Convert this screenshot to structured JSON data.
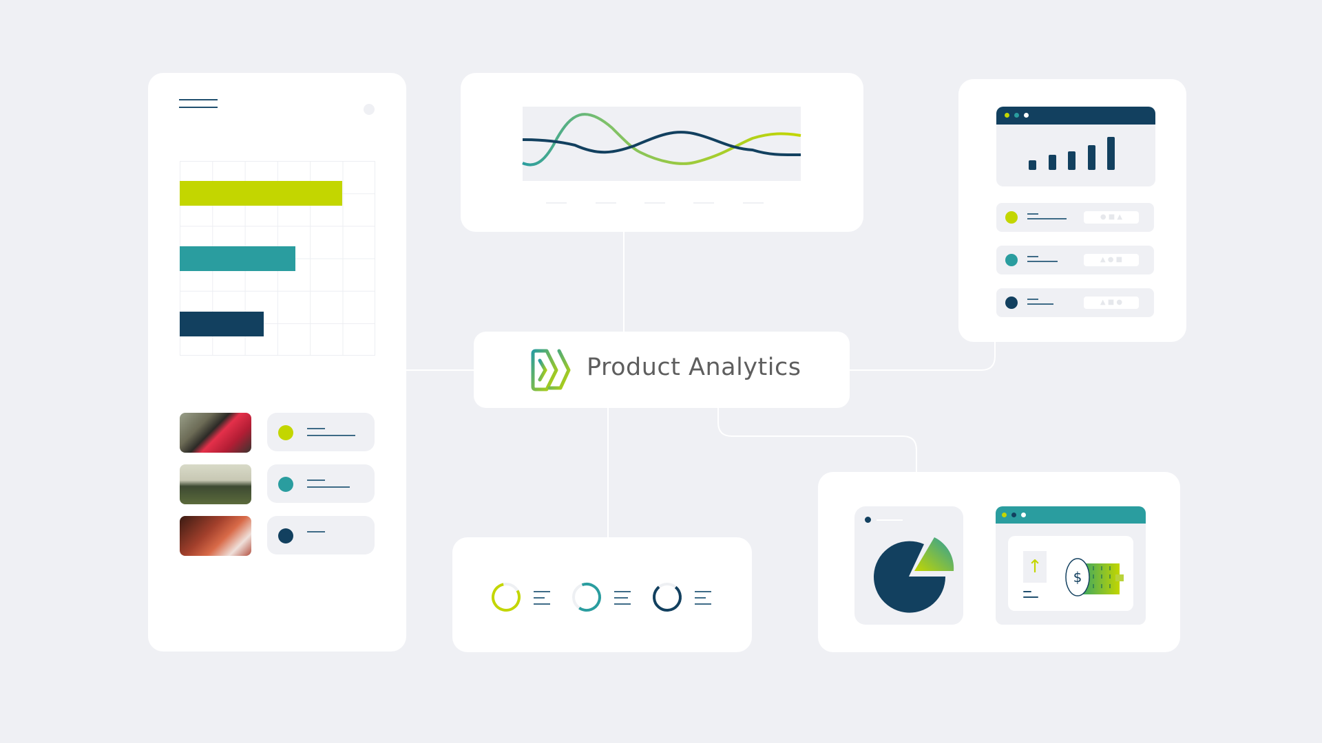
{
  "center_label": {
    "title": "Product Analytics",
    "logo": "chevron-logo"
  },
  "colors": {
    "lime": "#c3d600",
    "teal": "#2a9d9f",
    "navy": "#12405f",
    "background": "#eff0f4",
    "text": "#5e5e5e"
  },
  "left_card": {
    "bars": [
      {
        "color": "#c3d600",
        "fraction": 0.83
      },
      {
        "color": "#2a9d9f",
        "fraction": 0.59
      },
      {
        "color": "#12405f",
        "fraction": 0.43
      }
    ],
    "list_items": [
      {
        "image": "race-car-photo",
        "color": "#c3d600"
      },
      {
        "image": "football-players-photo",
        "color": "#2a9d9f"
      },
      {
        "image": "painting-close-up-photo",
        "color": "#12405f"
      }
    ]
  },
  "top_right_card": {
    "bar_heights": [
      0.3,
      0.45,
      0.57,
      0.74,
      1.0
    ],
    "rows": [
      {
        "color": "#c3d600",
        "icons": [
          "circle",
          "square",
          "triangle"
        ]
      },
      {
        "color": "#2a9d9f",
        "icons": [
          "triangle",
          "circle",
          "square"
        ]
      },
      {
        "color": "#12405f",
        "icons": [
          "triangle",
          "square",
          "circle"
        ]
      }
    ]
  },
  "progress_rings": [
    {
      "color": "#c3d600",
      "fraction": 0.8
    },
    {
      "color": "#2a9d9f",
      "fraction": 0.65
    },
    {
      "color": "#12405f",
      "fraction": 0.78
    }
  ],
  "bottom_right_card": {
    "pie_icon": "pie-chart-icon",
    "coin_icon": "dollar-coins-icon",
    "arrow_icon": "arrow-up-icon"
  }
}
